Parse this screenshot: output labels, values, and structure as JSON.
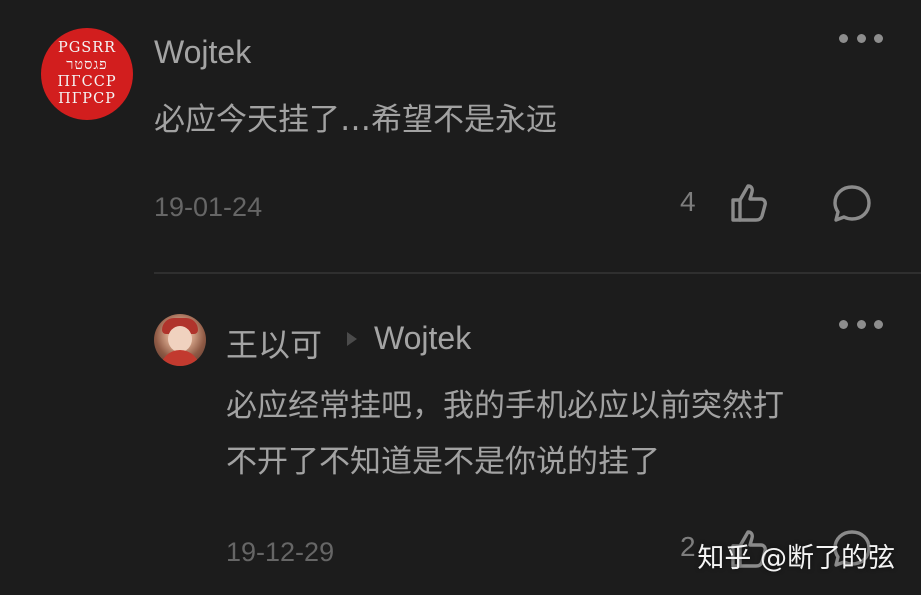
{
  "comment": {
    "avatar": {
      "lines": [
        "PGSRR",
        "פגסטר",
        "ПГССР",
        "ПГРСР"
      ],
      "background_color": "#d21e1e"
    },
    "username": "Wojtek",
    "text": "必应今天挂了…希望不是永远",
    "date": "19-01-24",
    "like_count": "4",
    "icons": [
      "more-icon",
      "thumbs-up-icon",
      "comment-bubble-icon"
    ]
  },
  "reply": {
    "username": "王以可",
    "reply_to": "Wojtek",
    "text_lines": [
      "必应经常挂吧，我的手机必应以前突然打",
      "不开了不知道是不是你说的挂了"
    ],
    "date": "19-12-29",
    "like_count": "2",
    "icons": [
      "more-icon",
      "reply-arrow-icon",
      "thumbs-up-icon",
      "comment-bubble-icon"
    ]
  },
  "watermark": "知乎 @断了的弦",
  "colors": {
    "background": "#1c1c1c",
    "text": "#a2a2a2",
    "muted": "#666666",
    "divider": "#2f2f2f"
  }
}
